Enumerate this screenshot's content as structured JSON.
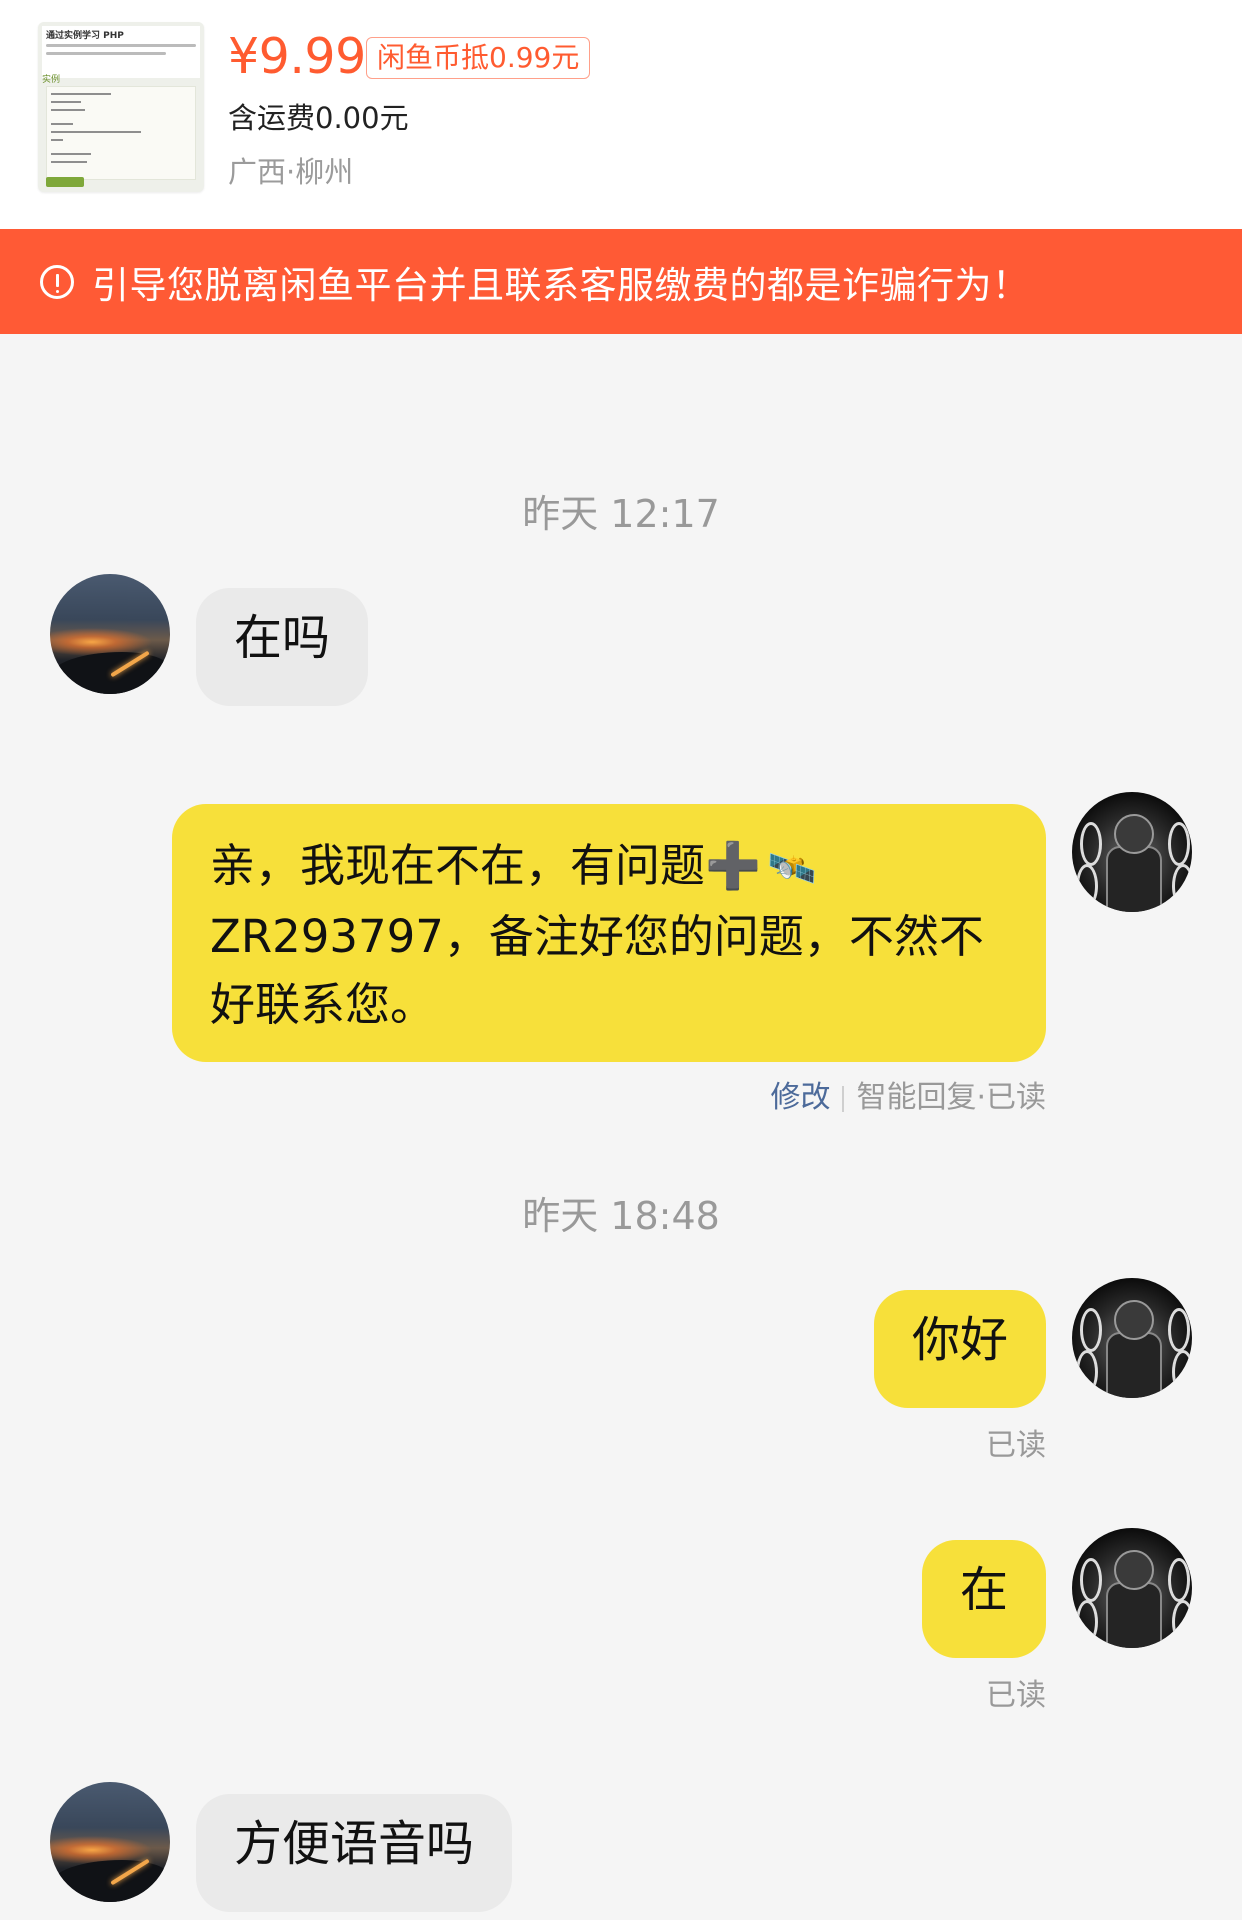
{
  "product": {
    "thumbnail_title": "通过实例学习 PHP",
    "thumbnail_tab": "实例",
    "price": "¥9.99",
    "coin_badge": "闲鱼币抵0.99元",
    "shipping": "含运费0.00元",
    "location": "广西·柳州"
  },
  "warning": {
    "text": "引导您脱离闲鱼平台并且联系客服缴费的都是诈骗行为！",
    "icon": "exclamation-circle-icon",
    "color": "#ff5a35"
  },
  "chat": {
    "timestamps": [
      "昨天 12:17",
      "昨天 18:48"
    ],
    "messages": [
      {
        "side": "left",
        "text": "在吗"
      },
      {
        "side": "right",
        "line1": "亲，我现在不在，有问题",
        "plus": "➕",
        "emoji": "🛰️",
        "line2": "ZR293797，备注好您的问题，不然不好联系您。",
        "edit_label": "修改",
        "status": "智能回复·已读"
      },
      {
        "side": "right",
        "text": "你好",
        "status": "已读"
      },
      {
        "side": "right",
        "text": "在",
        "status": "已读"
      },
      {
        "side": "left",
        "text": "方便语音吗"
      }
    ]
  },
  "colors": {
    "accent": "#ff5b30",
    "outgoing_bubble": "#f7e03a",
    "incoming_bubble": "#eaeaea"
  }
}
